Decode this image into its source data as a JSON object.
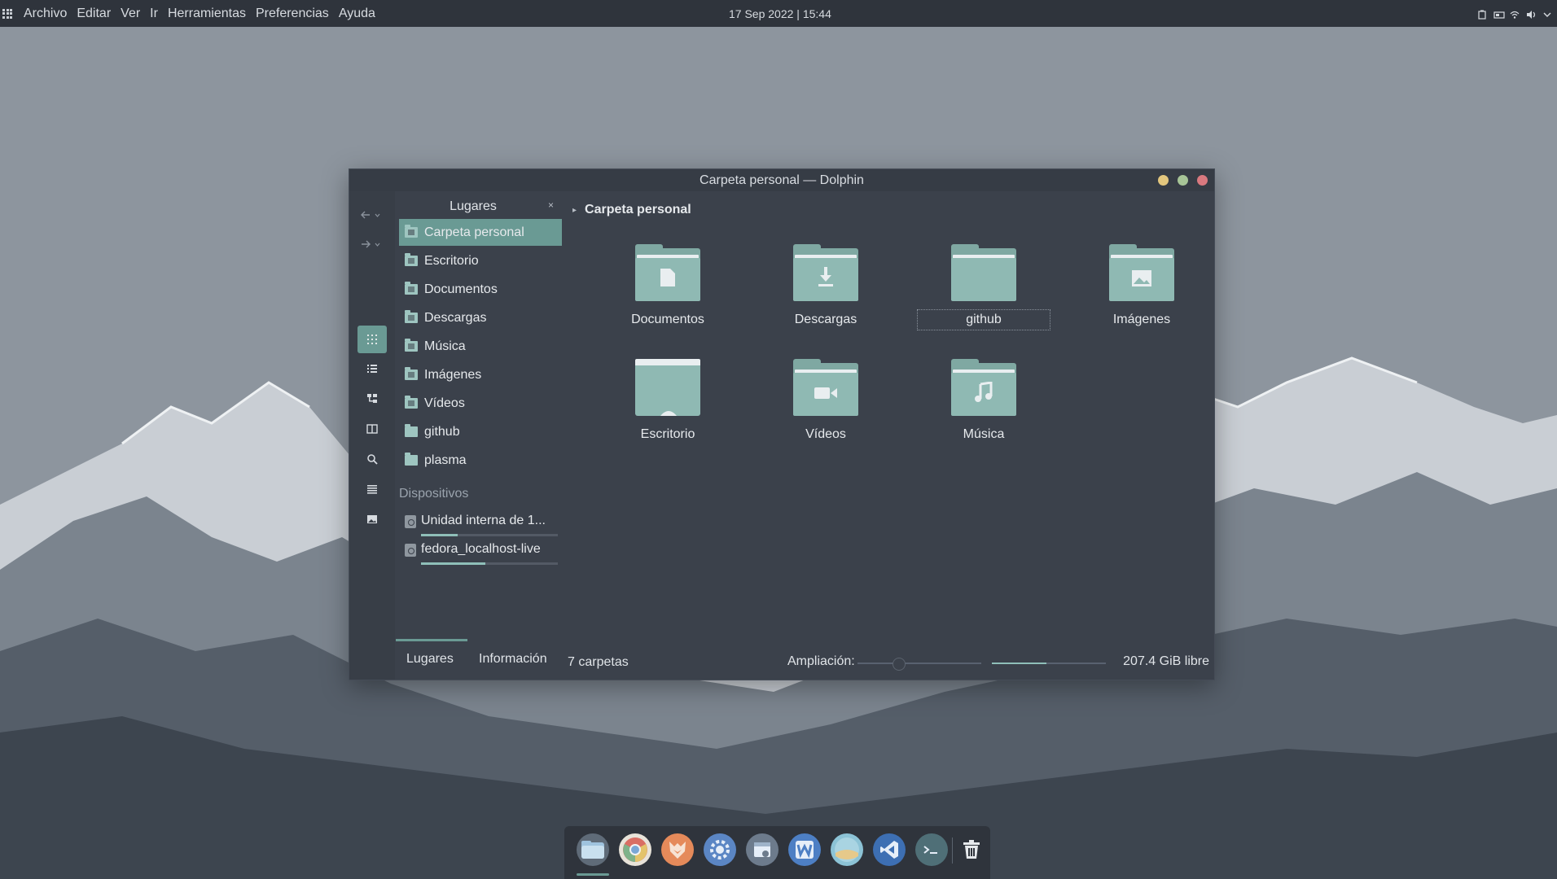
{
  "topbar": {
    "menu": [
      "Archivo",
      "Editar",
      "Ver",
      "Ir",
      "Herramientas",
      "Preferencias",
      "Ayuda"
    ],
    "clock": "17 Sep 2022 | 15:44",
    "tray_icons": [
      "battery-icon",
      "storage-icon",
      "wifi-icon",
      "volume-icon",
      "chevron-down-icon"
    ]
  },
  "window": {
    "title": "Carpeta personal — Dolphin",
    "accent": "#6a9a94"
  },
  "places": {
    "title": "Lugares",
    "close": "×",
    "items": [
      {
        "label": "Carpeta personal",
        "selected": true
      },
      {
        "label": "Escritorio"
      },
      {
        "label": "Documentos"
      },
      {
        "label": "Descargas"
      },
      {
        "label": "Música"
      },
      {
        "label": "Imágenes"
      },
      {
        "label": "Vídeos"
      },
      {
        "label": "github"
      },
      {
        "label": "plasma"
      }
    ],
    "devices_label": "Dispositivos",
    "devices": [
      {
        "label": "Unidad interna de 1...",
        "usage": 0.27
      },
      {
        "label": "fedora_localhost-live",
        "usage": 0.47
      }
    ],
    "tabs": [
      "Lugares",
      "Información"
    ]
  },
  "main": {
    "breadcrumb": "Carpeta personal",
    "folders": [
      {
        "label": "Documentos",
        "icon": "document-icon"
      },
      {
        "label": "Descargas",
        "icon": "download-icon"
      },
      {
        "label": "github",
        "icon": "folder-icon"
      },
      {
        "label": "Imágenes",
        "icon": "image-icon"
      },
      {
        "label": "Escritorio",
        "icon": "desktop-icon"
      },
      {
        "label": "Vídeos",
        "icon": "video-icon"
      },
      {
        "label": "Música",
        "icon": "music-icon"
      }
    ]
  },
  "statusbar": {
    "count": "7 carpetas",
    "zoom_label": "Ampliación:",
    "zoom_level": 0.33,
    "free_space": "207.4 GiB libre",
    "disk_usage": 0.48
  },
  "dock": {
    "apps": [
      "file-manager-icon",
      "chrome-icon",
      "firefox-icon",
      "settings-icon",
      "software-store-icon",
      "writer-icon",
      "image-viewer-icon",
      "vscode-icon",
      "terminal-icon",
      "trash-icon"
    ]
  }
}
